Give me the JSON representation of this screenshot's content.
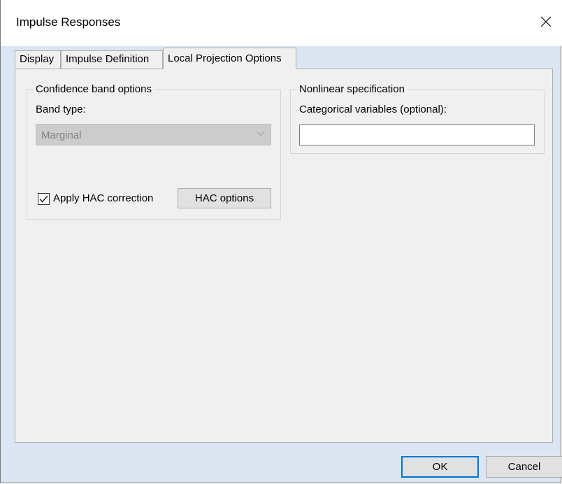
{
  "window": {
    "title": "Impulse Responses"
  },
  "tabs": [
    {
      "label": "Display",
      "active": false
    },
    {
      "label": "Impulse Definition",
      "active": false
    },
    {
      "label": "Local Projection Options",
      "active": true
    }
  ],
  "confidence_group": {
    "legend": "Confidence band options",
    "band_type_label": "Band type:",
    "band_type_value": "Marginal",
    "band_type_disabled": true,
    "hac_checkbox_label": "Apply HAC correction",
    "hac_checked": true,
    "hac_options_button": "HAC options"
  },
  "nonlinear_group": {
    "legend": "Nonlinear specification",
    "categorical_label": "Categorical variables (optional):",
    "categorical_value": ""
  },
  "footer": {
    "ok_label": "OK",
    "cancel_label": "Cancel"
  },
  "icons": {
    "close": "close-icon",
    "dropdown": "chevron-down-icon",
    "check": "checkmark-icon"
  },
  "colors": {
    "dialog_bg": "#dce6f2",
    "panel_bg": "#f0f0f0",
    "default_button_border": "#0078d7"
  }
}
